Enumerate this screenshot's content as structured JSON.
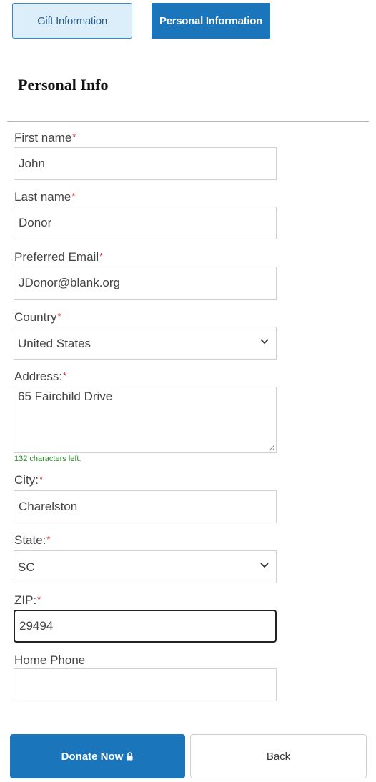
{
  "tabs": {
    "gift_label": "Gift Information",
    "personal_label": "Personal Information"
  },
  "heading": "Personal Info",
  "required_marker": "*",
  "form": {
    "first_name": {
      "label": "First name",
      "value": "John"
    },
    "last_name": {
      "label": "Last name",
      "value": "Donor"
    },
    "email": {
      "label": "Preferred Email",
      "value": "JDonor@blank.org"
    },
    "country": {
      "label": "Country",
      "value": "United States"
    },
    "address": {
      "label": "Address:",
      "value": "65 Fairchild Drive",
      "chars_left": "132 characters left."
    },
    "city": {
      "label": "City:",
      "value": "Charelston"
    },
    "state": {
      "label": "State:",
      "value": "SC"
    },
    "zip": {
      "label": "ZIP:",
      "value": "29494"
    },
    "home_phone": {
      "label": "Home Phone",
      "value": ""
    }
  },
  "buttons": {
    "donate_label": "Donate Now",
    "back_label": "Back"
  },
  "icons": {
    "select_caret": "chevron-down-icon",
    "donate_lock": "lock-icon",
    "textarea_resize": "resize-handle-icon"
  },
  "colors": {
    "primary": "#1a75bb",
    "required": "#d0312d",
    "char_count": "#2a8a2a",
    "tab_inactive_bg": "#ddeefb"
  }
}
